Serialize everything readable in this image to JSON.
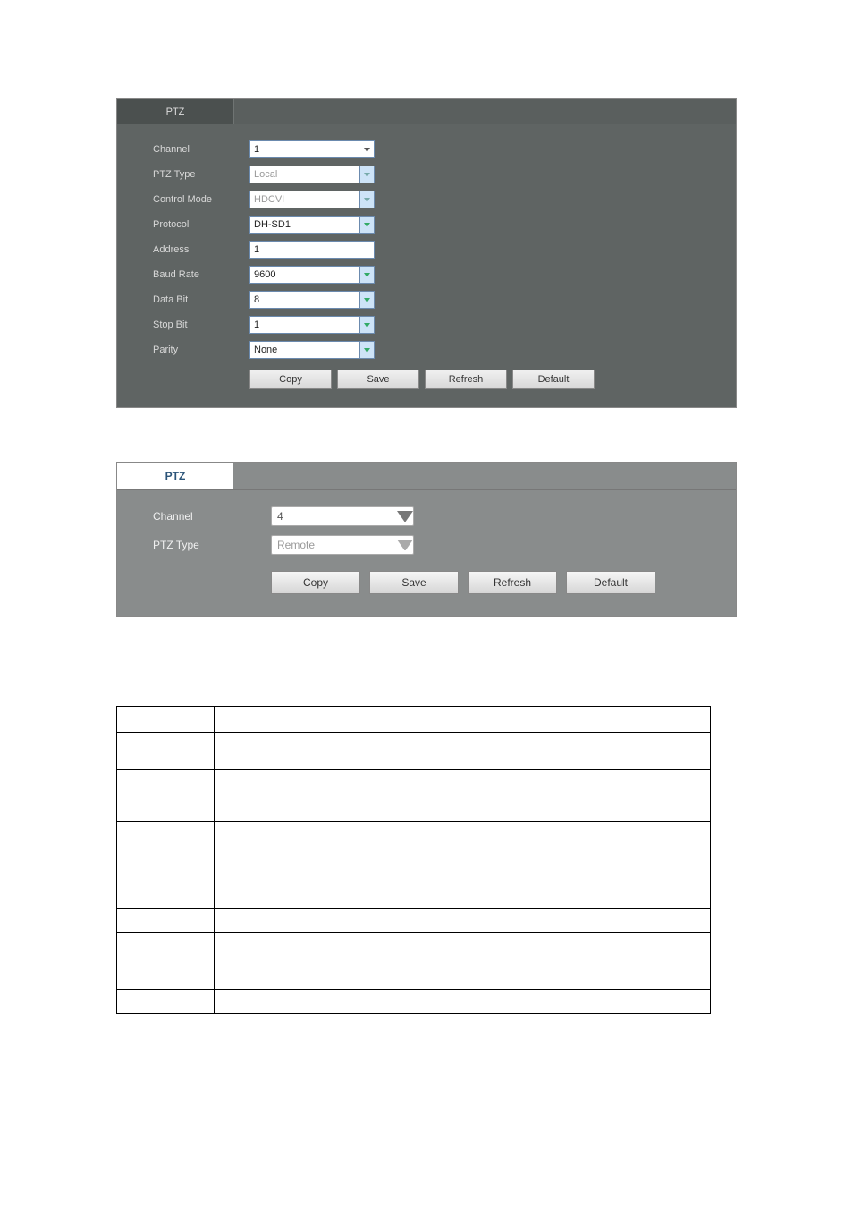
{
  "panel1": {
    "tab_label": "PTZ",
    "fields": {
      "channel": {
        "label": "Channel",
        "value": "1"
      },
      "ptz_type": {
        "label": "PTZ Type",
        "value": "Local"
      },
      "control_mode": {
        "label": "Control Mode",
        "value": "HDCVI"
      },
      "protocol": {
        "label": "Protocol",
        "value": "DH-SD1"
      },
      "address": {
        "label": "Address",
        "value": "1"
      },
      "baud_rate": {
        "label": "Baud Rate",
        "value": "9600"
      },
      "data_bit": {
        "label": "Data Bit",
        "value": "8"
      },
      "stop_bit": {
        "label": "Stop Bit",
        "value": "1"
      },
      "parity": {
        "label": "Parity",
        "value": "None"
      }
    },
    "buttons": {
      "copy": "Copy",
      "save": "Save",
      "refresh": "Refresh",
      "default": "Default"
    }
  },
  "panel2": {
    "tab_label": "PTZ",
    "fields": {
      "channel": {
        "label": "Channel",
        "value": "4"
      },
      "ptz_type": {
        "label": "PTZ Type",
        "value": "Remote"
      }
    },
    "buttons": {
      "copy": "Copy",
      "save": "Save",
      "refresh": "Refresh",
      "default": "Default"
    }
  }
}
